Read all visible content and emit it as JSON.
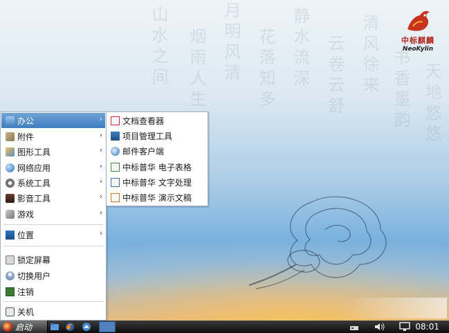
{
  "desktop": {
    "logo": {
      "cn": "中标麒麟",
      "en": "NeoKylin"
    }
  },
  "main_menu": {
    "items": [
      {
        "label": "办公",
        "icon": "office-folder-icon",
        "has_submenu": true,
        "highlighted": true
      },
      {
        "label": "附件",
        "icon": "accessories-icon",
        "has_submenu": true
      },
      {
        "label": "图形工具",
        "icon": "graphics-icon",
        "has_submenu": true
      },
      {
        "label": "网络应用",
        "icon": "internet-globe-icon",
        "has_submenu": true
      },
      {
        "label": "系统工具",
        "icon": "system-gear-icon",
        "has_submenu": true
      },
      {
        "label": "影音工具",
        "icon": "multimedia-icon",
        "has_submenu": true
      },
      {
        "label": "游戏",
        "icon": "games-icon",
        "has_submenu": true
      },
      {
        "label": "位置",
        "icon": "places-folder-icon",
        "has_submenu": true
      },
      {
        "label": "锁定屏幕",
        "icon": "lock-screen-icon"
      },
      {
        "label": "切换用户",
        "icon": "switch-user-icon"
      },
      {
        "label": "注销",
        "icon": "logout-icon"
      },
      {
        "label": "关机",
        "icon": "shutdown-icon"
      }
    ]
  },
  "sub_menu": {
    "items": [
      {
        "label": "文档查看器",
        "icon": "document-viewer-icon"
      },
      {
        "label": "项目管理工具",
        "icon": "project-management-icon"
      },
      {
        "label": "邮件客户端",
        "icon": "mail-client-icon"
      },
      {
        "label": "中标普华 电子表格",
        "icon": "spreadsheet-icon"
      },
      {
        "label": "中标普华 文字处理",
        "icon": "word-processor-icon"
      },
      {
        "label": "中标普华 演示文稿",
        "icon": "presentation-icon"
      }
    ]
  },
  "taskbar": {
    "start_label": "启动",
    "clock": "08:01",
    "tray_icons": [
      "network-icon",
      "volume-icon",
      "display-icon"
    ],
    "launchers": [
      "file-manager-icon",
      "firefox-icon",
      "mail-icon"
    ]
  }
}
